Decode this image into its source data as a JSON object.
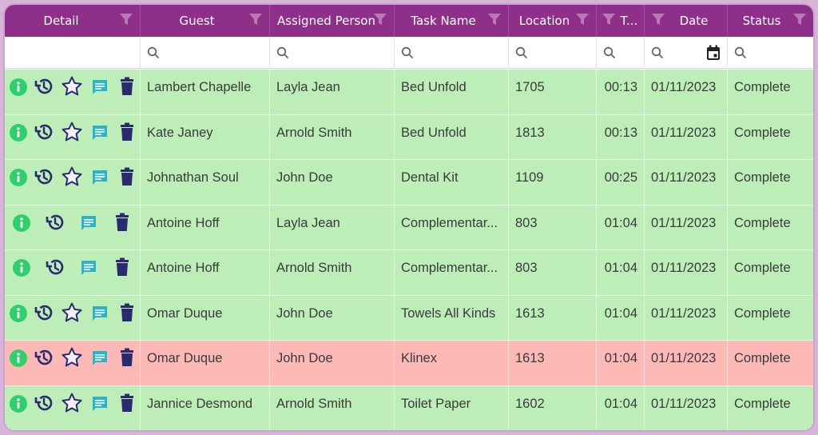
{
  "header": {
    "columns": [
      {
        "label": "Detail",
        "filter_icon": "funnel-icon"
      },
      {
        "label": "Guest",
        "filter_icon": "funnel-icon"
      },
      {
        "label": "Assigned Person",
        "filter_icon": "funnel-icon"
      },
      {
        "label": "Task Name",
        "filter_icon": "funnel-icon"
      },
      {
        "label": "Location",
        "filter_icon": "funnel-icon"
      },
      {
        "label": "T...",
        "filter_icon": "funnel-icon"
      },
      {
        "label": "Date",
        "filter_icon": "funnel-icon"
      },
      {
        "label": "Status",
        "filter_icon": "funnel-icon"
      }
    ]
  },
  "filters": {
    "search_icon": "search-icon",
    "date_picker_icon": "calendar-icon"
  },
  "colors": {
    "header_bg": "#8e2f8a",
    "row_green": "#bdeeb8",
    "row_red": "#fcb9b6",
    "info_green": "#2fcf6b",
    "history_navy": "#2a2a70",
    "chat_teal": "#2bb3c8",
    "trash_navy": "#2a2a70"
  },
  "rows": [
    {
      "guest": "Lambert Chapelle",
      "assigned": "Layla Jean",
      "task": "Bed Unfold",
      "location": "1705",
      "time": "00:13",
      "date": "01/11/2023",
      "status": "Complete",
      "highlight": "green",
      "star": true
    },
    {
      "guest": "Kate Janey",
      "assigned": "Arnold Smith",
      "task": "Bed Unfold",
      "location": "1813",
      "time": "00:13",
      "date": "01/11/2023",
      "status": "Complete",
      "highlight": "green",
      "star": true
    },
    {
      "guest": "Johnathan Soul",
      "assigned": "John Doe",
      "task": "Dental Kit",
      "location": "1109",
      "time": "00:25",
      "date": "01/11/2023",
      "status": "Complete",
      "highlight": "green",
      "star": true
    },
    {
      "guest": "Antoine Hoff",
      "assigned": "Layla Jean",
      "task": "Complementar...",
      "location": "803",
      "time": "01:04",
      "date": "01/11/2023",
      "status": "Complete",
      "highlight": "green",
      "star": false
    },
    {
      "guest": "Antoine Hoff",
      "assigned": "Arnold Smith",
      "task": "Complementar...",
      "location": "803",
      "time": "01:04",
      "date": "01/11/2023",
      "status": "Complete",
      "highlight": "green",
      "star": false
    },
    {
      "guest": "Omar Duque",
      "assigned": "John Doe",
      "task": "Towels All Kinds",
      "location": "1613",
      "time": "01:04",
      "date": "01/11/2023",
      "status": "Complete",
      "highlight": "green",
      "star": true
    },
    {
      "guest": "Omar Duque",
      "assigned": "John Doe",
      "task": "Klinex",
      "location": "1613",
      "time": "01:04",
      "date": "01/11/2023",
      "status": "Complete",
      "highlight": "red",
      "star": true
    },
    {
      "guest": "Jannice Desmond",
      "assigned": "Arnold Smith",
      "task": "Toilet Paper",
      "location": "1602",
      "time": "01:04",
      "date": "01/11/2023",
      "status": "Complete",
      "highlight": "green",
      "star": true
    }
  ]
}
